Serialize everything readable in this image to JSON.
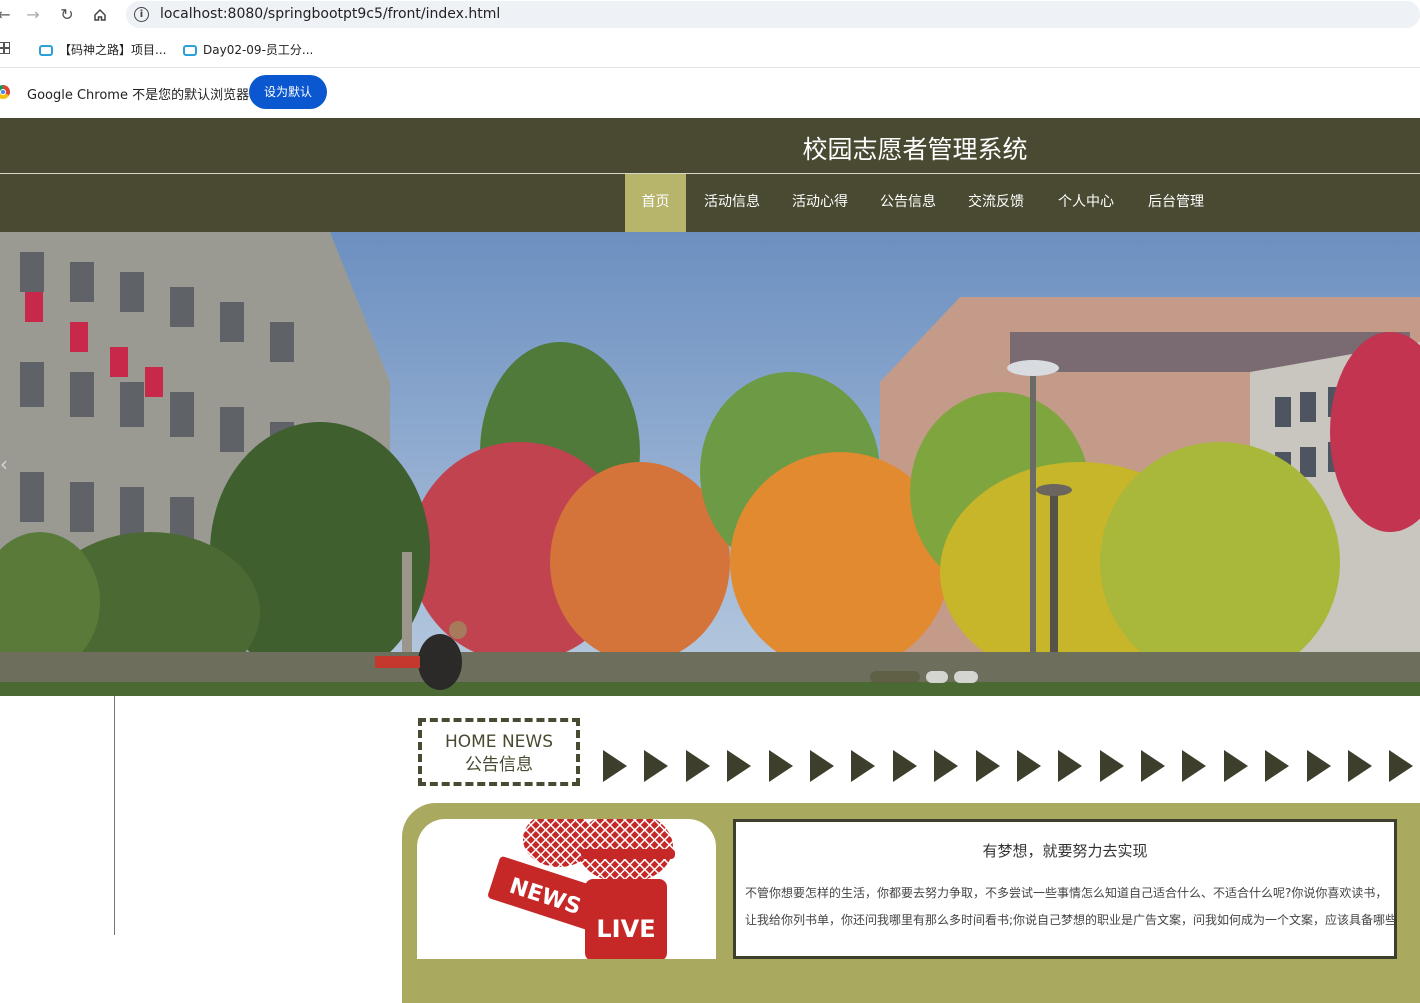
{
  "browser": {
    "url": "localhost:8080/springbootpt9c5/front/index.html",
    "bookmarks": [
      {
        "label": "【码神之路】项目..."
      },
      {
        "label": "Day02-09-员工分..."
      }
    ],
    "infobar": {
      "message": "Google Chrome 不是您的默认浏览器",
      "button_label": "设为默认"
    }
  },
  "site": {
    "title": "校园志愿者管理系统",
    "nav": [
      {
        "label": "首页",
        "active": true
      },
      {
        "label": "活动信息"
      },
      {
        "label": "活动心得"
      },
      {
        "label": "公告信息"
      },
      {
        "label": "交流反馈"
      },
      {
        "label": "个人中心"
      },
      {
        "label": "后台管理"
      }
    ],
    "colors": {
      "header": "#4a4a33",
      "nav_active": "#b7b46c",
      "panel": "#a9a960"
    }
  },
  "banner": {
    "slides": 3,
    "active_slide": 1
  },
  "news": {
    "heading_en": "HOME NEWS",
    "heading_cn": "公告信息",
    "image_text_1": "NEWS",
    "image_text_2": "LIVE",
    "article": {
      "title": "有梦想，就要努力去实现",
      "line1": "不管你想要怎样的生活，你都要去努力争取，不多尝试一些事情怎么知道自己适合什么、不适合什么呢?你说你喜欢读书，",
      "line2": "让我给你列书单，你还问我哪里有那么多时间看书;你说自己梦想的职业是广告文案，问我如何成为一个文案，应该具备哪些"
    }
  }
}
